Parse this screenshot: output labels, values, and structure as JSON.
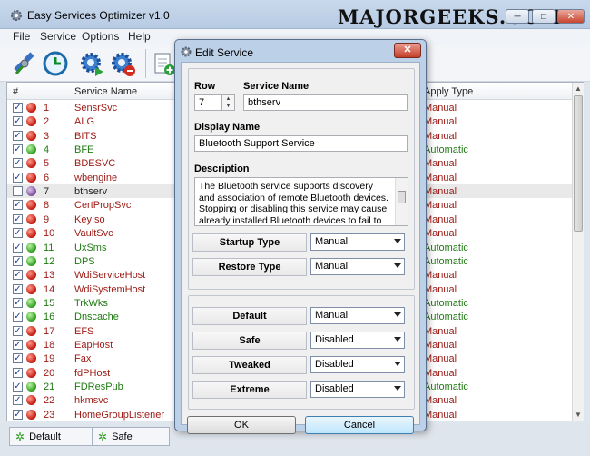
{
  "window": {
    "title": "Easy Services Optimizer v1.0",
    "watermark": "MAJORGEEKS.COM",
    "min": "─",
    "max": "□",
    "close": "✕"
  },
  "menu": [
    "File",
    "Service",
    "Options",
    "Help"
  ],
  "toolbar_icons": [
    "satellite-icon",
    "refresh-clock-icon",
    "gear-play-icon",
    "gear-stop-icon",
    "add-document-icon"
  ],
  "grid": {
    "headers": {
      "num": "#",
      "name": "Service Name",
      "apply": "Apply Type"
    },
    "rows": [
      {
        "n": "1",
        "name": "SensrSvc",
        "status": "red",
        "checked": true,
        "apply": "Manual"
      },
      {
        "n": "2",
        "name": "ALG",
        "status": "red",
        "checked": true,
        "apply": "Manual"
      },
      {
        "n": "3",
        "name": "BITS",
        "status": "red",
        "checked": true,
        "apply": "Manual"
      },
      {
        "n": "4",
        "name": "BFE",
        "status": "green",
        "checked": true,
        "apply": "Automatic"
      },
      {
        "n": "5",
        "name": "BDESVC",
        "status": "red",
        "checked": true,
        "apply": "Manual"
      },
      {
        "n": "6",
        "name": "wbengine",
        "status": "red",
        "checked": true,
        "apply": "Manual"
      },
      {
        "n": "7",
        "name": "bthserv",
        "status": "purple",
        "checked": false,
        "apply": "Manual"
      },
      {
        "n": "8",
        "name": "CertPropSvc",
        "status": "red",
        "checked": true,
        "apply": "Manual"
      },
      {
        "n": "9",
        "name": "KeyIso",
        "status": "red",
        "checked": true,
        "apply": "Manual"
      },
      {
        "n": "10",
        "name": "VaultSvc",
        "status": "red",
        "checked": true,
        "apply": "Manual"
      },
      {
        "n": "11",
        "name": "UxSms",
        "status": "green",
        "checked": true,
        "apply": "Automatic"
      },
      {
        "n": "12",
        "name": "DPS",
        "status": "green",
        "checked": true,
        "apply": "Automatic"
      },
      {
        "n": "13",
        "name": "WdiServiceHost",
        "status": "red",
        "checked": true,
        "apply": "Manual"
      },
      {
        "n": "14",
        "name": "WdiSystemHost",
        "status": "red",
        "checked": true,
        "apply": "Manual"
      },
      {
        "n": "15",
        "name": "TrkWks",
        "status": "green",
        "checked": true,
        "apply": "Automatic"
      },
      {
        "n": "16",
        "name": "Dnscache",
        "status": "green",
        "checked": true,
        "apply": "Automatic"
      },
      {
        "n": "17",
        "name": "EFS",
        "status": "red",
        "checked": true,
        "apply": "Manual"
      },
      {
        "n": "18",
        "name": "EapHost",
        "status": "red",
        "checked": true,
        "apply": "Manual"
      },
      {
        "n": "19",
        "name": "Fax",
        "status": "red",
        "checked": true,
        "apply": "Manual"
      },
      {
        "n": "20",
        "name": "fdPHost",
        "status": "red",
        "checked": true,
        "apply": "Manual"
      },
      {
        "n": "21",
        "name": "FDResPub",
        "status": "green",
        "checked": true,
        "apply": "Automatic"
      },
      {
        "n": "22",
        "name": "hkmsvc",
        "status": "red",
        "checked": true,
        "apply": "Manual"
      },
      {
        "n": "23",
        "name": "HomeGroupListener",
        "status": "red",
        "checked": true,
        "apply": "Manual"
      }
    ]
  },
  "tabs": [
    {
      "label": "Default"
    },
    {
      "label": "Safe"
    }
  ],
  "dialog": {
    "title": "Edit Service",
    "close": "✕",
    "row_label": "Row",
    "row_value": "7",
    "service_name_label": "Service Name",
    "service_name_value": "bthserv",
    "display_name_label": "Display Name",
    "display_name_value": "Bluetooth Support Service",
    "description_label": "Description",
    "description_value": "The Bluetooth service supports discovery and association of remote Bluetooth devices. Stopping or disabling this service may cause already installed Bluetooth devices to fail to",
    "fields": [
      {
        "label": "Startup Type",
        "value": "Manual"
      },
      {
        "label": "Restore Type",
        "value": "Manual"
      }
    ],
    "profiles": [
      {
        "label": "Default",
        "value": "Manual"
      },
      {
        "label": "Safe",
        "value": "Disabled"
      },
      {
        "label": "Tweaked",
        "value": "Disabled"
      },
      {
        "label": "Extreme",
        "value": "Disabled"
      }
    ],
    "ok_label": "OK",
    "cancel_label": "Cancel"
  }
}
